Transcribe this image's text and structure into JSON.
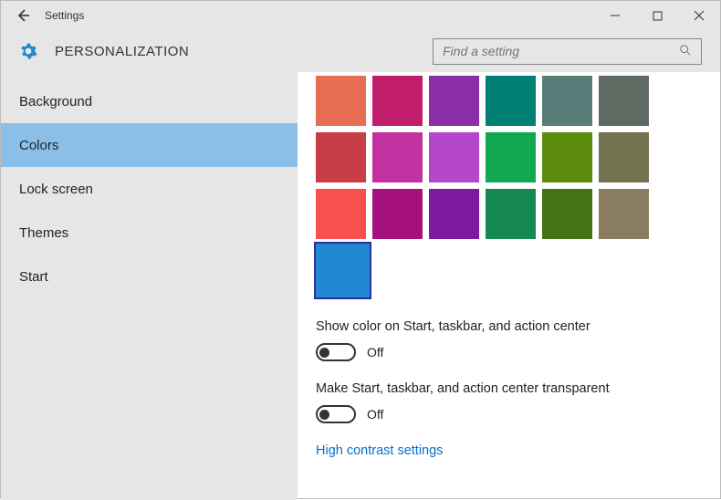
{
  "titlebar": {
    "title": "Settings"
  },
  "subheader": {
    "category": "PERSONALIZATION"
  },
  "search": {
    "placeholder": "Find a setting"
  },
  "sidebar": {
    "items": [
      {
        "label": "Background",
        "selected": false
      },
      {
        "label": "Colors",
        "selected": true
      },
      {
        "label": "Lock screen",
        "selected": false
      },
      {
        "label": "Themes",
        "selected": false
      },
      {
        "label": "Start",
        "selected": false
      }
    ]
  },
  "colors": {
    "rows": [
      [
        "#e86d54",
        "#c21d6b",
        "#8a2fa5",
        "#008074",
        "#567d78",
        "#5d6b62"
      ],
      [
        "#c83d46",
        "#c330a0",
        "#b548c9",
        "#10a951",
        "#5c8c0c",
        "#72724e"
      ],
      [
        "#f94f4f",
        "#a5127e",
        "#7d1a9e",
        "#168950",
        "#457314",
        "#8a7c63"
      ]
    ],
    "selected": "#1f8ad1"
  },
  "settings": {
    "show_color": {
      "label": "Show color on Start, taskbar, and action center",
      "state": "Off",
      "on": false
    },
    "transparent": {
      "label": "Make Start, taskbar, and action center transparent",
      "state": "Off",
      "on": false
    }
  },
  "link": {
    "high_contrast": "High contrast settings"
  }
}
